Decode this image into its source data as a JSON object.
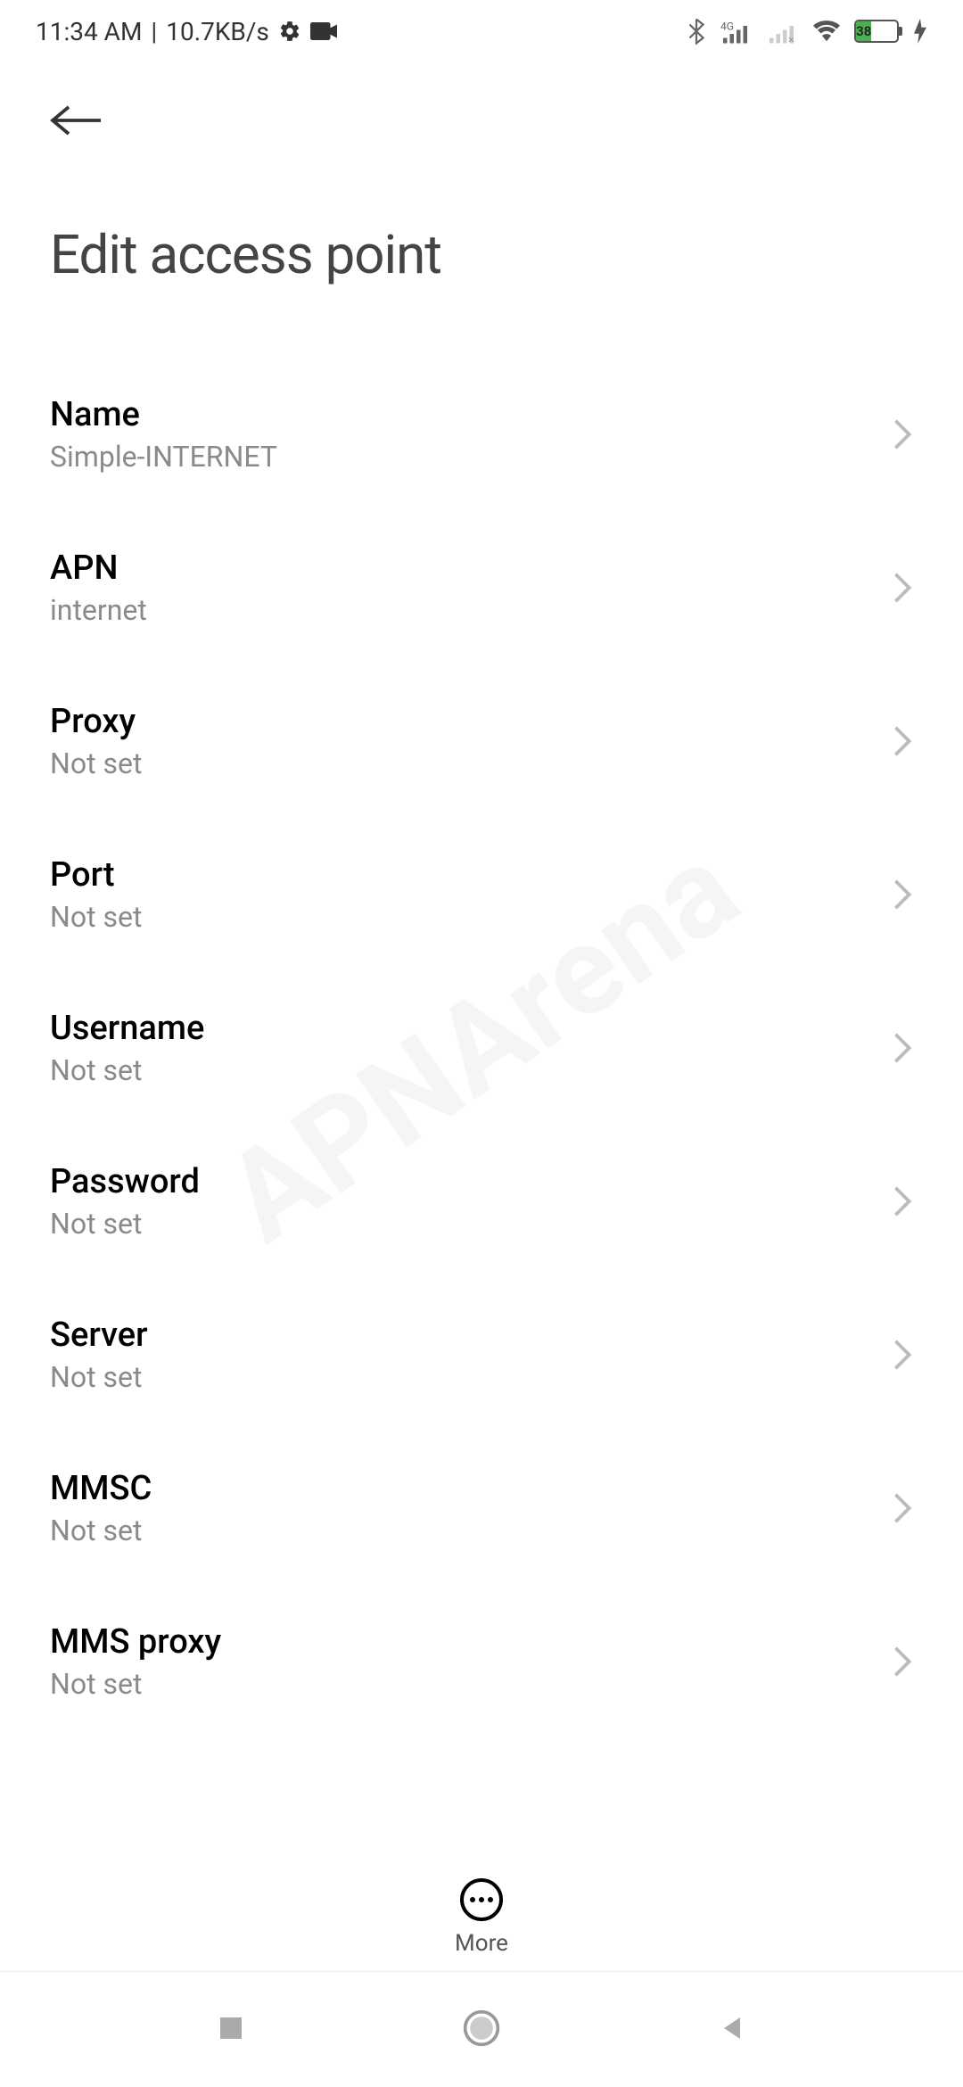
{
  "status": {
    "time": "11:34 AM",
    "speed": "10.7KB/s",
    "battery": "38"
  },
  "header": {
    "title": "Edit access point"
  },
  "settings": [
    {
      "label": "Name",
      "value": "Simple-INTERNET"
    },
    {
      "label": "APN",
      "value": "internet"
    },
    {
      "label": "Proxy",
      "value": "Not set"
    },
    {
      "label": "Port",
      "value": "Not set"
    },
    {
      "label": "Username",
      "value": "Not set"
    },
    {
      "label": "Password",
      "value": "Not set"
    },
    {
      "label": "Server",
      "value": "Not set"
    },
    {
      "label": "MMSC",
      "value": "Not set"
    },
    {
      "label": "MMS proxy",
      "value": "Not set"
    }
  ],
  "footer": {
    "more": "More"
  },
  "watermark": "APNArena"
}
